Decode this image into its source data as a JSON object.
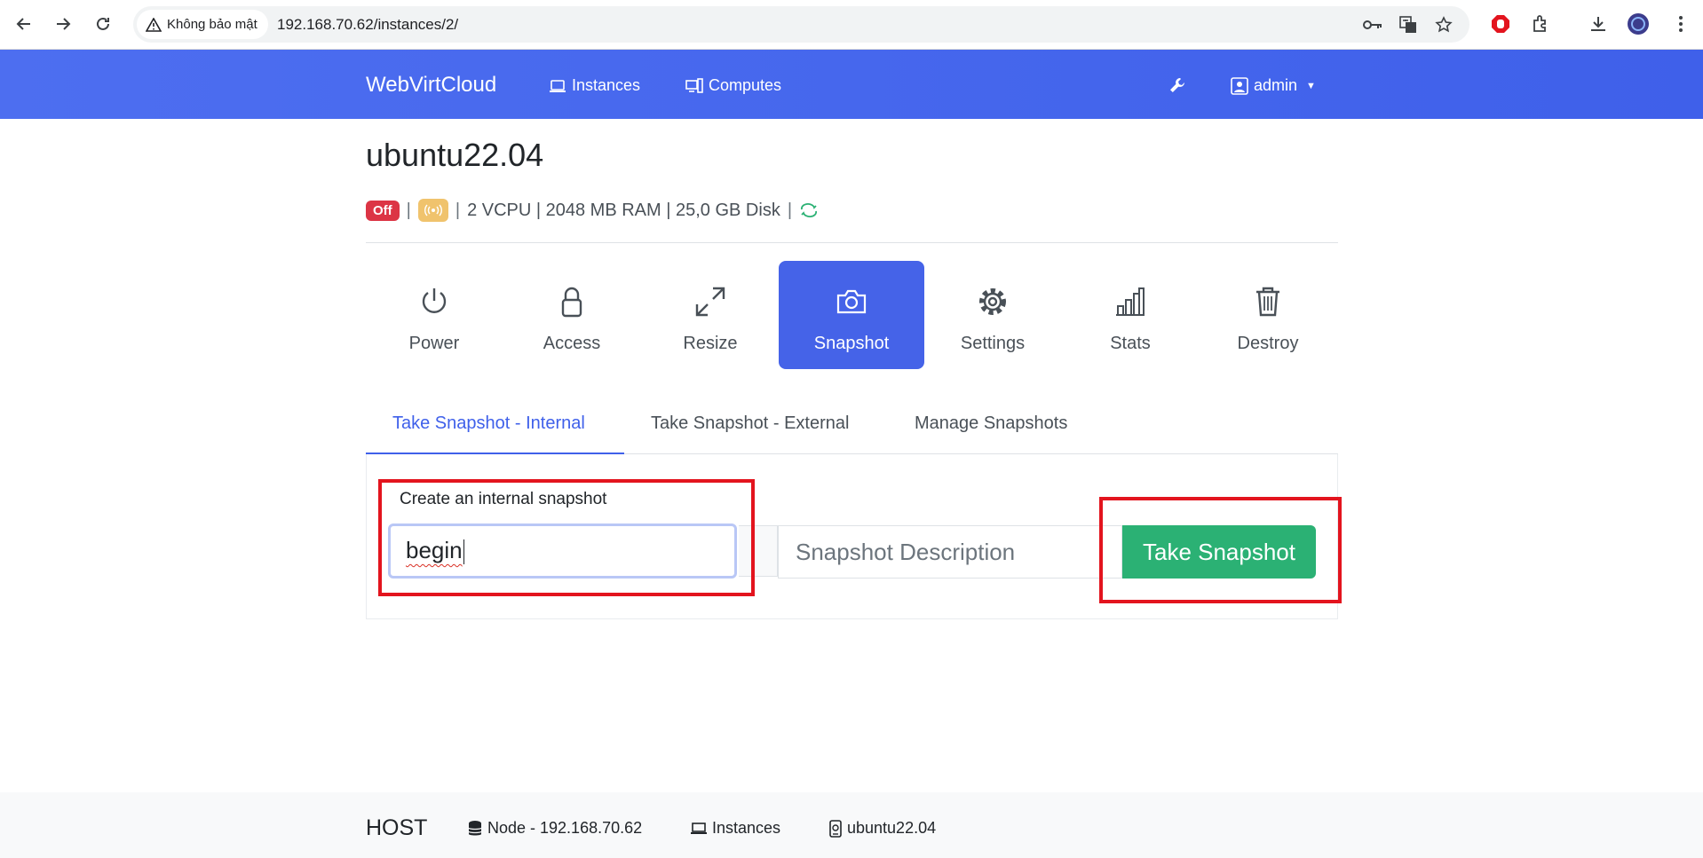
{
  "browser": {
    "security_label": "Không bảo mật",
    "url": "192.168.70.62/instances/2/"
  },
  "navbar": {
    "brand": "WebVirtCloud",
    "instances_label": "Instances",
    "computes_label": "Computes",
    "user_label": "admin"
  },
  "instance": {
    "name": "ubuntu22.04",
    "status_badge": "Off",
    "specs": "2 VCPU | 2048 MB RAM | 25,0 GB Disk"
  },
  "actions": [
    {
      "label": "Power",
      "icon": "power-icon"
    },
    {
      "label": "Access",
      "icon": "lock-icon"
    },
    {
      "label": "Resize",
      "icon": "expand-icon"
    },
    {
      "label": "Snapshot",
      "icon": "camera-icon",
      "active": true
    },
    {
      "label": "Settings",
      "icon": "gear-icon"
    },
    {
      "label": "Stats",
      "icon": "bar-chart-icon"
    },
    {
      "label": "Destroy",
      "icon": "trash-icon"
    }
  ],
  "tabs": [
    {
      "label": "Take Snapshot - Internal",
      "active": true
    },
    {
      "label": "Take Snapshot - External"
    },
    {
      "label": "Manage Snapshots"
    }
  ],
  "form": {
    "label": "Create an internal snapshot",
    "name_value": "begin",
    "description_placeholder": "Snapshot Description",
    "submit_label": "Take Snapshot"
  },
  "footer": {
    "host": "HOST",
    "node": "Node - 192.168.70.62",
    "instances": "Instances",
    "instance": "ubuntu22.04"
  },
  "colors": {
    "navbar": "#4563e8",
    "active_tab": "#3f60ea",
    "success": "#2bb174",
    "danger": "#dc3545",
    "highlight": "#e3141e"
  }
}
